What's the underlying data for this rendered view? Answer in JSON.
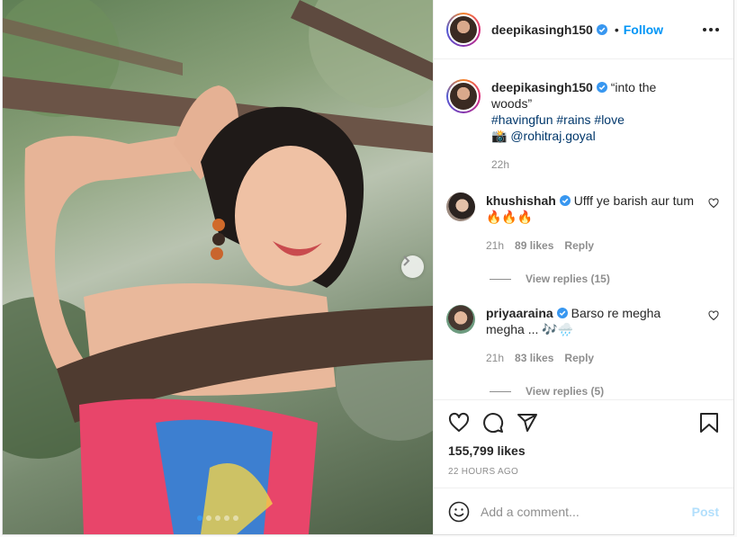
{
  "post": {
    "username": "deepikasingh150",
    "follow_label": "Follow",
    "separator": "•",
    "caption_quote": "“into the woods”",
    "caption_hashtags": "#havingfun #rains #love",
    "caption_credit": "📸 @rohitraj.goyal",
    "caption_age": "22h",
    "likes": "155,799 likes",
    "posted": "22 HOURS AGO",
    "carousel": {
      "slides": 5,
      "active_index": 0
    }
  },
  "comments": [
    {
      "username": "khushishah",
      "text": "Ufff ye barish aur tum 🔥🔥🔥",
      "age": "21h",
      "likes": "89 likes",
      "reply_label": "Reply",
      "view_replies": "View replies (15)"
    },
    {
      "username": "priyaaraina",
      "text": "Barso re megha megha ... 🎶🌧️",
      "age": "21h",
      "likes": "83 likes",
      "reply_label": "Reply",
      "view_replies": "View replies (5)"
    }
  ],
  "add_comment": {
    "placeholder": "Add a comment...",
    "post_label": "Post"
  },
  "icons": {
    "verified": "verified-badge-icon",
    "more": "more-options-icon",
    "like": "heart-icon",
    "comment": "comment-icon",
    "share": "share-icon",
    "save": "bookmark-icon",
    "emoji": "emoji-icon",
    "next": "chevron-right-icon"
  },
  "colors": {
    "accent": "#0095f6",
    "verified": "#3897f0",
    "muted": "#8e8e8e",
    "text": "#262626",
    "post_disabled": "#b2dffc"
  }
}
